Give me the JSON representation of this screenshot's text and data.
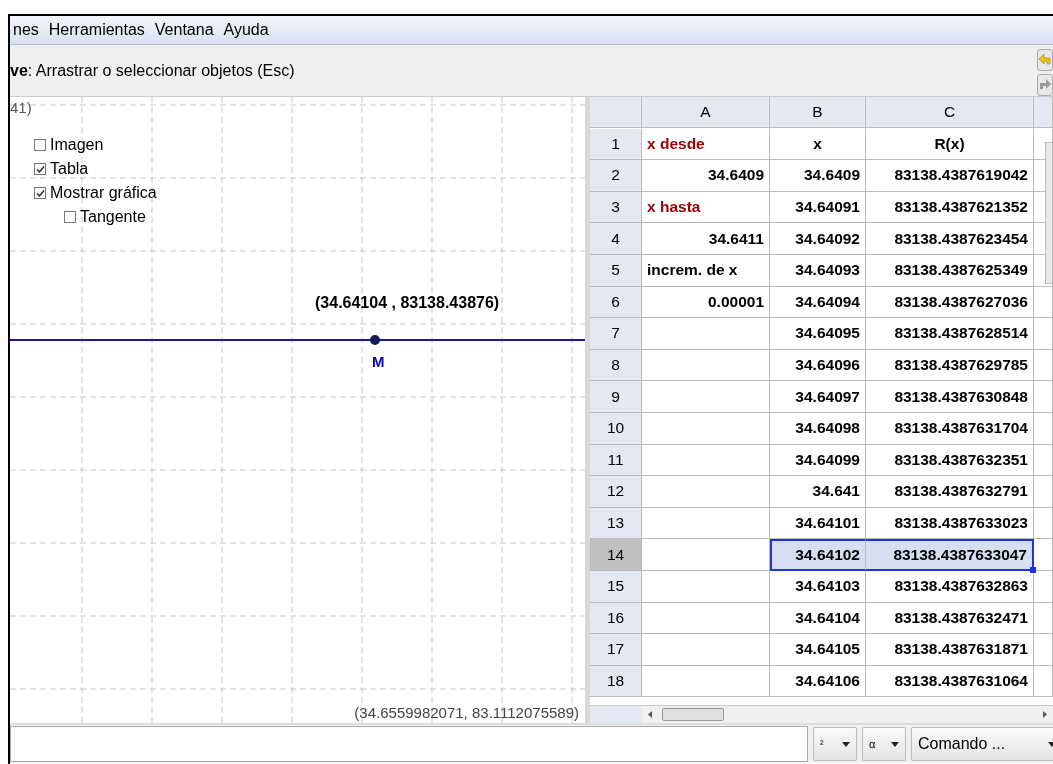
{
  "menu": [
    "nes",
    "Herramientas",
    "Ventana",
    "Ayuda"
  ],
  "toolbar": {
    "help": "**ve**: Arrastrar o seleccionar objetos (Esc)"
  },
  "graphics": {
    "corner_label": "41)",
    "checkboxes": [
      {
        "label": "Imagen",
        "checked": false
      },
      {
        "label": "Tabla",
        "checked": true
      },
      {
        "label": "Mostrar gráfica",
        "checked": true,
        "children": [
          {
            "label": "Tangente",
            "checked": false
          }
        ]
      }
    ],
    "point_coords": "(34.64104 , 83138.43876)",
    "point_name": "M",
    "mouse_coords": "(34.6559982071, 83.1112075589)"
  },
  "spreadsheet": {
    "columns": [
      "A",
      "B",
      "C"
    ],
    "rows": [
      {
        "n": "1",
        "selected": false,
        "cells": [
          {
            "kind": "label",
            "text": "x desde",
            "color": "#990000",
            "selected": false
          },
          {
            "kind": "heading",
            "text": "x",
            "selected": false
          },
          {
            "kind": "heading",
            "text": "R(x)",
            "selected": false
          }
        ]
      },
      {
        "n": "2",
        "selected": false,
        "cells": [
          {
            "kind": "number",
            "text": "34.6409",
            "selected": false
          },
          {
            "kind": "number",
            "text": "34.6409",
            "selected": false
          },
          {
            "kind": "number",
            "text": "83138.4387619042",
            "selected": false
          }
        ]
      },
      {
        "n": "3",
        "selected": false,
        "cells": [
          {
            "kind": "label",
            "text": "x hasta",
            "color": "#990000",
            "selected": false
          },
          {
            "kind": "number",
            "text": "34.64091",
            "selected": false
          },
          {
            "kind": "number",
            "text": "83138.4387621352",
            "selected": false
          }
        ]
      },
      {
        "n": "4",
        "selected": false,
        "cells": [
          {
            "kind": "number",
            "text": "34.6411",
            "selected": false
          },
          {
            "kind": "number",
            "text": "34.64092",
            "selected": false
          },
          {
            "kind": "number",
            "text": "83138.4387623454",
            "selected": false
          }
        ]
      },
      {
        "n": "5",
        "selected": false,
        "cells": [
          {
            "kind": "label",
            "text": "increm. de x",
            "color": "#000000",
            "selected": false
          },
          {
            "kind": "number",
            "text": "34.64093",
            "selected": false
          },
          {
            "kind": "number",
            "text": "83138.4387625349",
            "selected": false
          }
        ]
      },
      {
        "n": "6",
        "selected": false,
        "cells": [
          {
            "kind": "number",
            "text": "0.00001",
            "selected": false
          },
          {
            "kind": "number",
            "text": "34.64094",
            "selected": false
          },
          {
            "kind": "number",
            "text": "83138.4387627036",
            "selected": false
          }
        ]
      },
      {
        "n": "7",
        "selected": false,
        "cells": [
          {
            "kind": "empty",
            "selected": false
          },
          {
            "kind": "number",
            "text": "34.64095",
            "selected": false
          },
          {
            "kind": "number",
            "text": "83138.4387628514",
            "selected": false
          }
        ]
      },
      {
        "n": "8",
        "selected": false,
        "cells": [
          {
            "kind": "empty",
            "selected": false
          },
          {
            "kind": "number",
            "text": "34.64096",
            "selected": false
          },
          {
            "kind": "number",
            "text": "83138.4387629785",
            "selected": false
          }
        ]
      },
      {
        "n": "9",
        "selected": false,
        "cells": [
          {
            "kind": "empty",
            "selected": false
          },
          {
            "kind": "number",
            "text": "34.64097",
            "selected": false
          },
          {
            "kind": "number",
            "text": "83138.4387630848",
            "selected": false
          }
        ]
      },
      {
        "n": "10",
        "selected": false,
        "cells": [
          {
            "kind": "empty",
            "selected": false
          },
          {
            "kind": "number",
            "text": "34.64098",
            "selected": false
          },
          {
            "kind": "number",
            "text": "83138.4387631704",
            "selected": false
          }
        ]
      },
      {
        "n": "11",
        "selected": false,
        "cells": [
          {
            "kind": "empty",
            "selected": false
          },
          {
            "kind": "number",
            "text": "34.64099",
            "selected": false
          },
          {
            "kind": "number",
            "text": "83138.4387632351",
            "selected": false
          }
        ]
      },
      {
        "n": "12",
        "selected": false,
        "cells": [
          {
            "kind": "empty",
            "selected": false
          },
          {
            "kind": "number",
            "text": "34.641",
            "selected": false
          },
          {
            "kind": "number",
            "text": "83138.4387632791",
            "selected": false
          }
        ]
      },
      {
        "n": "13",
        "selected": false,
        "cells": [
          {
            "kind": "empty",
            "selected": false
          },
          {
            "kind": "number",
            "text": "34.64101",
            "selected": false
          },
          {
            "kind": "number",
            "text": "83138.4387633023",
            "selected": false
          }
        ]
      },
      {
        "n": "14",
        "selected": true,
        "cells": [
          {
            "kind": "empty",
            "selected": false
          },
          {
            "kind": "number",
            "text": "34.64102",
            "selected": true
          },
          {
            "kind": "number",
            "text": "83138.4387633047",
            "selected": true
          }
        ]
      },
      {
        "n": "15",
        "selected": false,
        "cells": [
          {
            "kind": "empty",
            "selected": false
          },
          {
            "kind": "number",
            "text": "34.64103",
            "selected": false
          },
          {
            "kind": "number",
            "text": "83138.4387632863",
            "selected": false
          }
        ]
      },
      {
        "n": "16",
        "selected": false,
        "cells": [
          {
            "kind": "empty",
            "selected": false
          },
          {
            "kind": "number",
            "text": "34.64104",
            "selected": false
          },
          {
            "kind": "number",
            "text": "83138.4387632471",
            "selected": false
          }
        ]
      },
      {
        "n": "17",
        "selected": false,
        "cells": [
          {
            "kind": "empty",
            "selected": false
          },
          {
            "kind": "number",
            "text": "34.64105",
            "selected": false
          },
          {
            "kind": "number",
            "text": "83138.4387631871",
            "selected": false
          }
        ]
      },
      {
        "n": "18",
        "selected": false,
        "cells": [
          {
            "kind": "empty",
            "selected": false
          },
          {
            "kind": "number",
            "text": "34.64106",
            "selected": false
          },
          {
            "kind": "number",
            "text": "83138.4387631064",
            "selected": false
          }
        ]
      }
    ]
  },
  "input_bar": {
    "dropdowns": [
      "²",
      "α",
      "Comando ..."
    ]
  }
}
